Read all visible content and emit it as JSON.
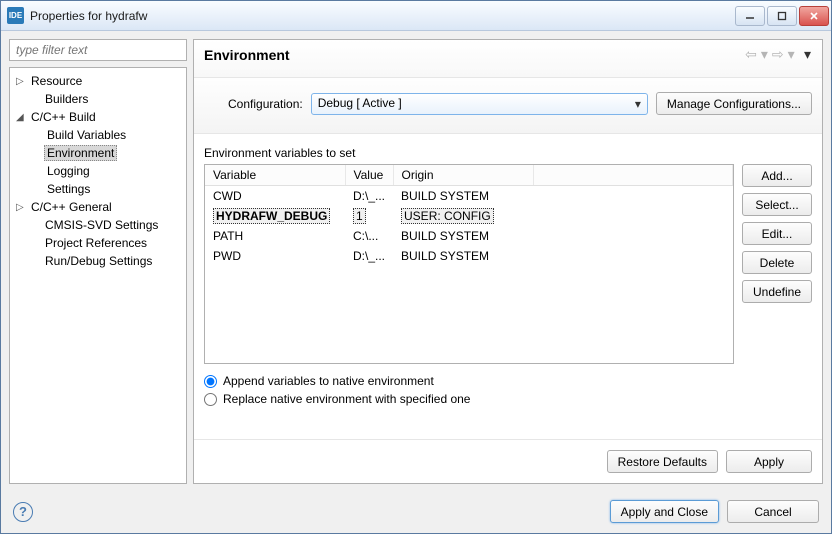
{
  "window": {
    "title": "Properties for hydrafw"
  },
  "filter": {
    "placeholder": "type filter text"
  },
  "tree": {
    "resource": "Resource",
    "builders": "Builders",
    "cppbuild": "C/C++ Build",
    "buildvars": "Build Variables",
    "environment": "Environment",
    "logging": "Logging",
    "settings": "Settings",
    "cppgeneral": "C/C++ General",
    "cmsis": "CMSIS-SVD Settings",
    "projrefs": "Project References",
    "rundebug": "Run/Debug Settings"
  },
  "header": {
    "title": "Environment"
  },
  "config": {
    "label": "Configuration:",
    "value": "Debug  [ Active ]",
    "manage": "Manage Configurations..."
  },
  "env": {
    "label": "Environment variables to set",
    "cols": {
      "variable": "Variable",
      "value": "Value",
      "origin": "Origin"
    },
    "rows": [
      {
        "variable": "CWD",
        "value": "D:\\_...",
        "origin": "BUILD SYSTEM"
      },
      {
        "variable": "HYDRAFW_DEBUG",
        "value": "1",
        "origin": "USER: CONFIG"
      },
      {
        "variable": "PATH",
        "value": "C:\\...",
        "origin": "BUILD SYSTEM"
      },
      {
        "variable": "PWD",
        "value": "D:\\_...",
        "origin": "BUILD SYSTEM"
      }
    ],
    "buttons": {
      "add": "Add...",
      "select": "Select...",
      "edit": "Edit...",
      "delete": "Delete",
      "undefine": "Undefine"
    },
    "radios": {
      "append": "Append variables to native environment",
      "replace": "Replace native environment with specified one"
    }
  },
  "footer": {
    "restore": "Restore Defaults",
    "apply": "Apply",
    "applyclose": "Apply and Close",
    "cancel": "Cancel"
  }
}
